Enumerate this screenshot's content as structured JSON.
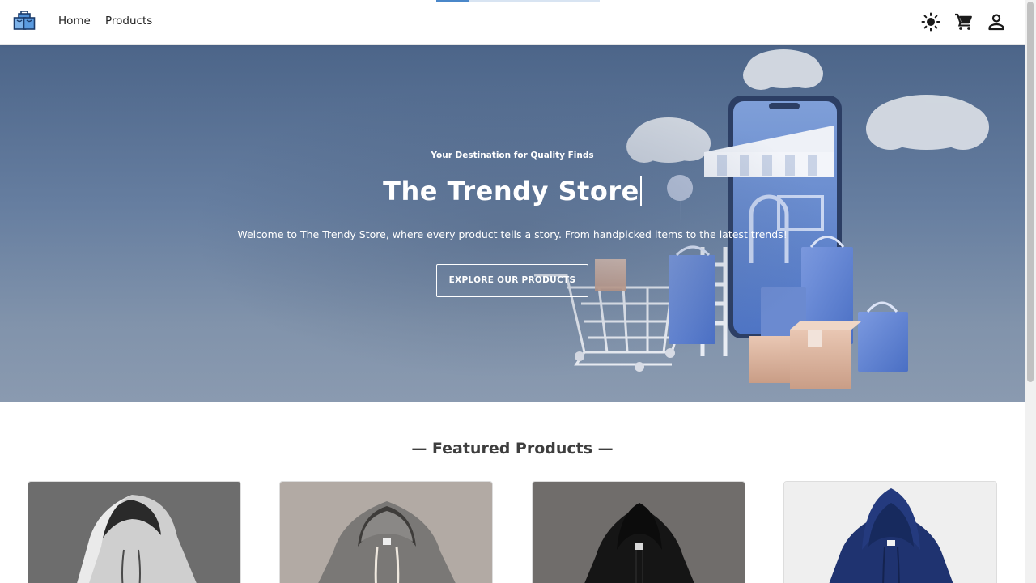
{
  "header": {
    "logo_icon": "shopping-bags-logo",
    "nav": [
      {
        "label": "Home"
      },
      {
        "label": "Products"
      }
    ],
    "icons": [
      "theme-toggle-sun-icon",
      "cart-icon",
      "user-icon"
    ],
    "loading_progress": 0.2
  },
  "hero": {
    "kicker": "Your Destination for Quality Finds",
    "title": "The Trendy Store",
    "description": "Welcome to The Trendy Store, where every product tells a story. From handpicked items to the latest trends!",
    "cta_label": "EXPLORE OUR PRODUCTS"
  },
  "featured": {
    "title": "— Featured Products —",
    "products": [
      {
        "image": "light-gray-hoodie"
      },
      {
        "image": "gray-hoodie"
      },
      {
        "image": "black-hoodie"
      },
      {
        "image": "navy-hoodie"
      }
    ]
  },
  "colors": {
    "accent": "#4a87c9",
    "hero_overlay": "#5a7398",
    "text_dark": "#222222"
  }
}
